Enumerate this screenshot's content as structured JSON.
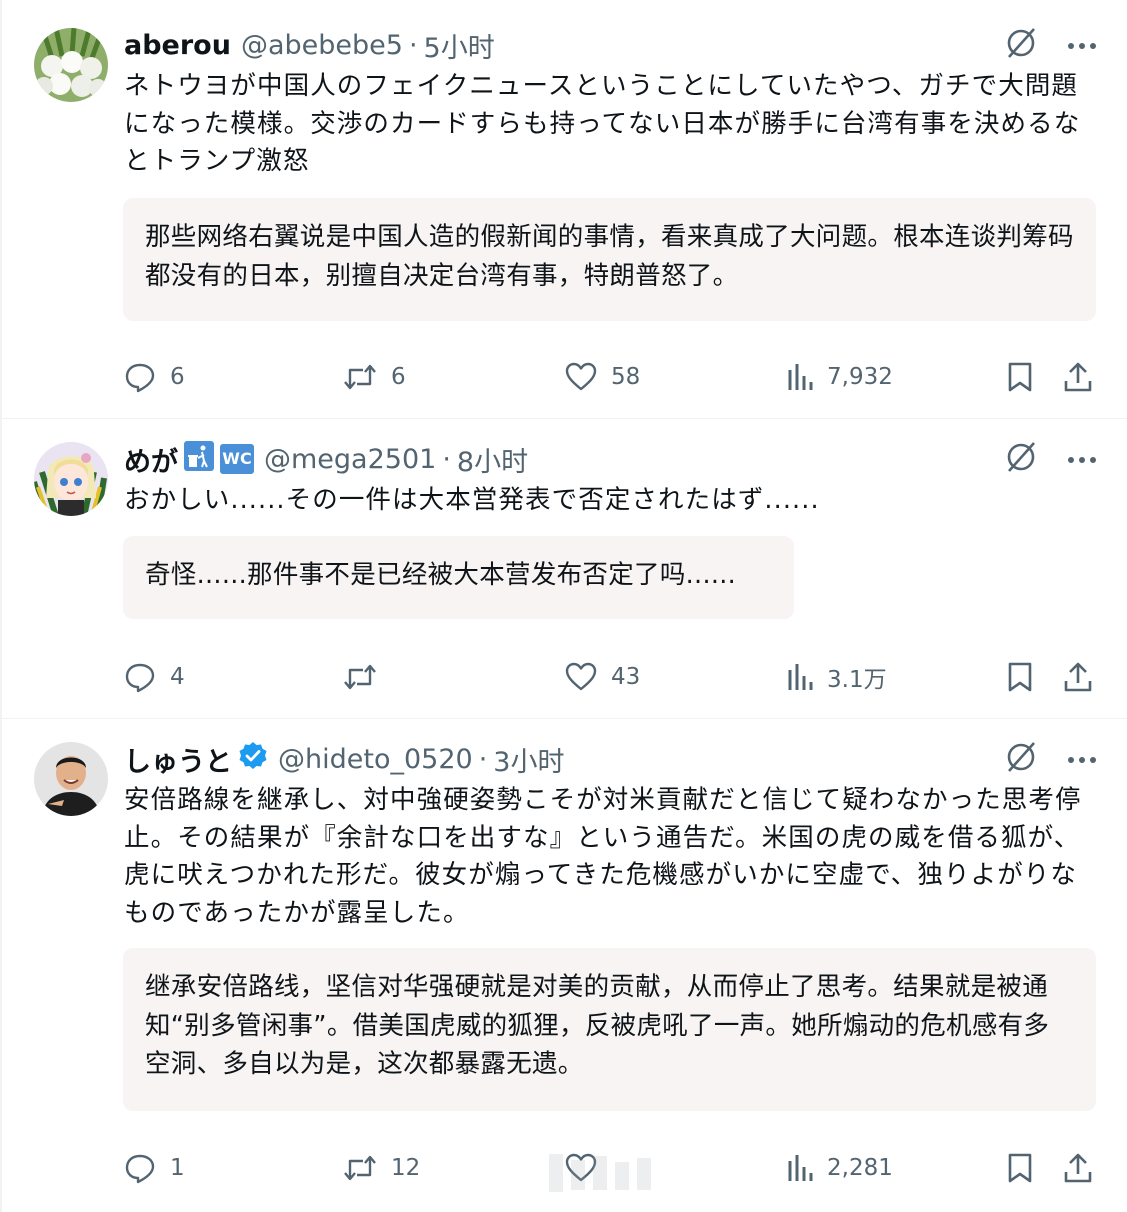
{
  "tweets": [
    {
      "name": "aberou",
      "handle": "@abebebe5",
      "dot": "·",
      "time": "5小时",
      "text": "ネトウヨが中国人のフェイクニュースということにしていたやつ、ガチで大問題になった模様。交渉のカードすらも持ってない日本が勝手に台湾有事を決めるなとトランプ激怒",
      "translation": "那些网络右翼说是中国人造的假新闻的事情，看来真成了大问题。根本连谈判筹码都没有的日本，别擅自决定台湾有事，特朗普怒了。",
      "stats": {
        "replies": "6",
        "reposts": "6",
        "likes": "58",
        "views": "7,932"
      }
    },
    {
      "name": "めが",
      "handle": "@mega2501",
      "dot": "·",
      "time": "8小时",
      "text": "おかしい......その一件は大本営発表で否定されたはず......",
      "translation": "奇怪......那件事不是已经被大本营发布否定了吗......",
      "badges": [
        "trash-person-icon",
        "wc-icon"
      ],
      "badge_wc_text": "WC",
      "stats": {
        "replies": "4",
        "reposts": "",
        "likes": "43",
        "views": "3.1万"
      }
    },
    {
      "name": "しゅうと",
      "handle": "@hideto_0520",
      "dot": "·",
      "time": "3小时",
      "text": "安倍路線を継承し、対中強硬姿勢こそが対米貢献だと信じて疑わなかった思考停止。その結果が『余計な口を出すな』という通告だ。米国の虎の威を借る狐が、虎に吠えつかれた形だ。彼女が煽ってきた危機感がいかに空虚で、独りよがりなものであったかが露呈した。",
      "translation": "继承安倍路线，坚信对华强硬就是对美的贡献，从而停止了思考。结果就是被通知“别多管闲事”。借美国虎威的狐狸，反被虎吼了一声。她所煽动的危机感有多空洞、多自以为是，这次都暴露无遗。",
      "verified": true,
      "stats": {
        "replies": "1",
        "reposts": "12",
        "likes": "",
        "views": "2,281"
      }
    }
  ],
  "icons": [
    "grok-slash-icon",
    "more-icon",
    "reply-icon",
    "repost-icon",
    "like-icon",
    "views-icon",
    "bookmark-icon",
    "share-icon"
  ],
  "colors": {
    "text": "#0f1419",
    "secondary": "#536471",
    "translation_bg": "#f7f4f3",
    "verified": "#1d9bf0",
    "badge_bg": "#4a90d9"
  }
}
